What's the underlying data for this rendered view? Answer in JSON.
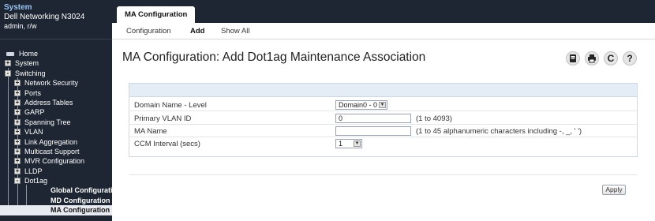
{
  "system": {
    "label": "System",
    "device": "Dell Networking N3024",
    "user": "admin, r/w"
  },
  "nav": {
    "items": [
      {
        "label": "Home"
      },
      {
        "label": "System",
        "expander": "+"
      },
      {
        "label": "Switching",
        "expander": "-"
      },
      {
        "label": "Network Security",
        "expander": "+"
      },
      {
        "label": "Ports",
        "expander": "+"
      },
      {
        "label": "Address Tables",
        "expander": "+"
      },
      {
        "label": "GARP",
        "expander": "+"
      },
      {
        "label": "Spanning Tree",
        "expander": "+"
      },
      {
        "label": "VLAN",
        "expander": "+"
      },
      {
        "label": "Link Aggregation",
        "expander": "+"
      },
      {
        "label": "Multicast Support",
        "expander": "+"
      },
      {
        "label": "MVR Configuration",
        "expander": "+"
      },
      {
        "label": "LLDP",
        "expander": "+"
      },
      {
        "label": "Dot1ag",
        "expander": "-"
      },
      {
        "label": "Global Configuratio"
      },
      {
        "label": "MD Configuration"
      },
      {
        "label": "MA Configuration"
      }
    ]
  },
  "topbar": {
    "main_tab": "MA Configuration",
    "subtabs": [
      "Configuration",
      "Add",
      "Show All"
    ]
  },
  "page": {
    "title": "MA Configuration: Add Dot1ag Maintenance Association"
  },
  "toolbar": {
    "icons": [
      "help-book-icon",
      "print-icon",
      "refresh-icon",
      "help-icon"
    ],
    "refresh_glyph": "C",
    "help_glyph": "?"
  },
  "form": {
    "rows": [
      {
        "label": "Domain Name - Level",
        "type": "select",
        "value": "Domain0 - 0",
        "hint": ""
      },
      {
        "label": "Primary VLAN ID",
        "type": "input",
        "value": "0",
        "hint": "(1 to 4093)"
      },
      {
        "label": "MA Name",
        "type": "input",
        "value": "",
        "hint": "(1 to 45 alphanumeric characters including -, _, ' ')"
      },
      {
        "label": "CCM Interval (secs)",
        "type": "select",
        "value": "1",
        "hint": ""
      }
    ],
    "apply_label": "Apply"
  },
  "colors": {
    "nav_bg": "#1e2633",
    "header_accent": "#9cc3f0",
    "form_header_bg": "#e4ecf5"
  }
}
